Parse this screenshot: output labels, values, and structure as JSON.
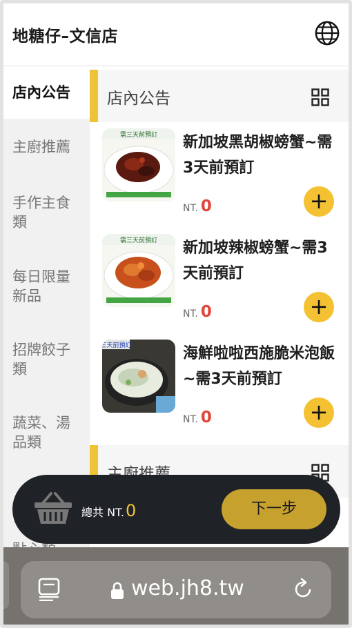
{
  "header": {
    "store_name": "地糖仔–文信店",
    "language_icon": "globe-icon"
  },
  "sidebar": {
    "items": [
      {
        "label": "店內公告",
        "active": true
      },
      {
        "label": "主廚推薦",
        "active": false
      },
      {
        "label": "手作主食類",
        "active": false
      },
      {
        "label": "每日限量新品",
        "active": false
      },
      {
        "label": "招牌餃子類",
        "active": false
      },
      {
        "label": "蔬菜、湯品類",
        "active": false
      },
      {
        "label": "點心類",
        "active": false
      }
    ]
  },
  "sections": [
    {
      "title": "店內公告",
      "items": [
        {
          "name": "新加坡黑胡椒螃蟹~需3天前預訂",
          "currency": "NT.",
          "price": "0",
          "thumb_caption": "需三天前預訂"
        },
        {
          "name": "新加坡辣椒螃蟹~需3天前預訂",
          "currency": "NT.",
          "price": "0",
          "thumb_caption": "需三天前預訂"
        },
        {
          "name": "海鮮啦啦西施脆米泡飯~需3天前預訂",
          "currency": "NT.",
          "price": "0",
          "thumb_caption": "三天前預訂"
        }
      ]
    },
    {
      "title": "主廚推薦"
    }
  ],
  "cart": {
    "label": "總共 NT.",
    "total": "0",
    "next_label": "下一步"
  },
  "browser": {
    "url": "web.jh8.tw"
  },
  "colors": {
    "accent": "#f0c336",
    "price": "#e0463a",
    "cart_bg": "#1f2226",
    "next_btn": "#c7a12e"
  }
}
